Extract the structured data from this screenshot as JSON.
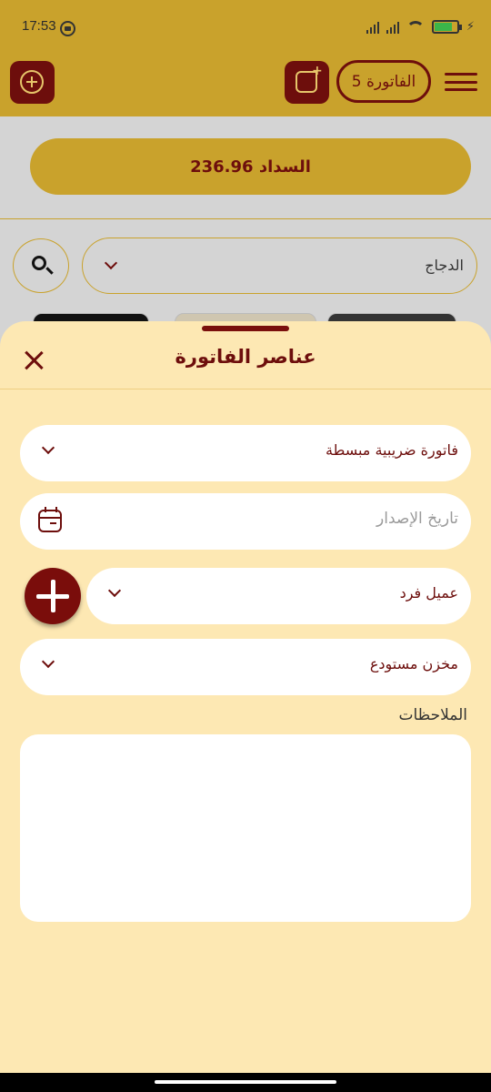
{
  "status_bar": {
    "time": "17:53",
    "battery_level": 0.72,
    "icons": [
      "notification-icon",
      "signal-icon",
      "wifi-icon",
      "battery-icon",
      "charging-icon"
    ]
  },
  "header": {
    "invoice_label": "الفاتورة 5",
    "icons": [
      "add-circle-icon",
      "new-note-icon",
      "menu-icon"
    ]
  },
  "background": {
    "payment_label": "السداد 236.96",
    "category_select": "الدجاج"
  },
  "sheet": {
    "title": "عناصر الفاتورة",
    "invoice_type": "فاتورة ضريبية مبسطة",
    "issue_date_placeholder": "تاريخ الإصدار",
    "customer": "عميل فرد",
    "warehouse": "مخزن مستودع",
    "notes_label": "الملاحظات",
    "notes_value": ""
  },
  "colors": {
    "brand_maroon": "#6d0e0c",
    "brand_gold": "#c9a22c",
    "sheet_bg": "#fde8b3"
  }
}
